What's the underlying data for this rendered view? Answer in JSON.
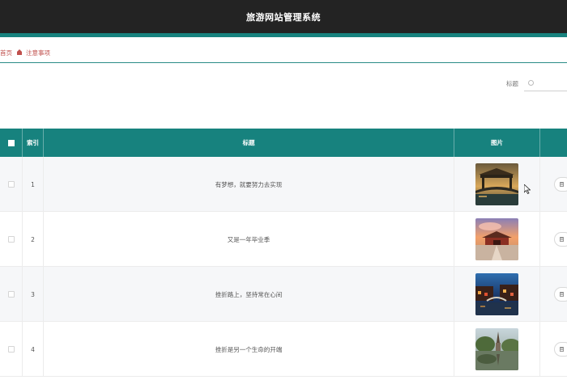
{
  "header": {
    "title": "旅游网站管理系统"
  },
  "breadcrumb": {
    "home": "首页",
    "current": "注意事项"
  },
  "search": {
    "label": "标题"
  },
  "table": {
    "columns": {
      "index": "索引",
      "title": "标题",
      "image": "图片"
    },
    "rows": [
      {
        "index": "1",
        "title": "有梦想，就要努力去实现",
        "image": "bridge-pavilion-photo"
      },
      {
        "index": "2",
        "title": "又是一年毕业季",
        "image": "palace-sunset-photo"
      },
      {
        "index": "3",
        "title": "挫折路上，坚持常在心间",
        "image": "canal-town-night-photo"
      },
      {
        "index": "4",
        "title": "挫折是另一个生命的开端",
        "image": "lake-church-photo"
      }
    ]
  },
  "colors": {
    "topbar": "#232323",
    "accent": "#17827e",
    "breadcrumb": "#c0504d"
  }
}
